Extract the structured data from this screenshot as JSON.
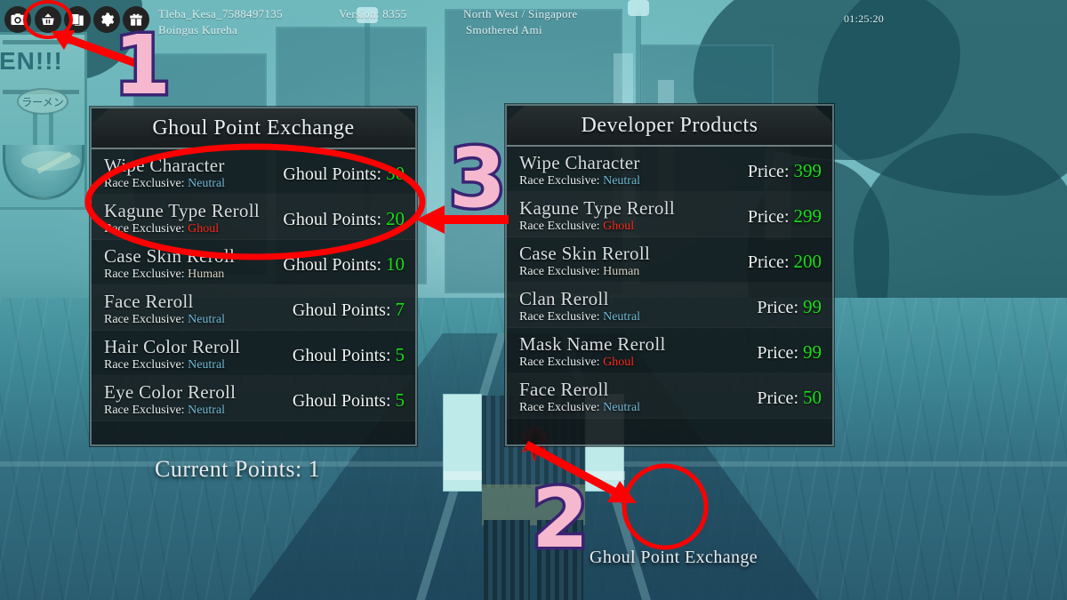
{
  "hud": {
    "icons": [
      {
        "name": "camera-icon",
        "label": "Screenshot"
      },
      {
        "name": "shop-basket-icon",
        "label": "Shop"
      },
      {
        "name": "inventory-book-icon",
        "label": "Inventory"
      },
      {
        "name": "gear-icon",
        "label": "Settings"
      },
      {
        "name": "gift-box-icon",
        "label": "Gifts"
      }
    ],
    "username": "Tleba_Kesa_7588497135",
    "display_name": "Boingus Kureha",
    "version": "Version: 8355",
    "region": "North West / Singapore",
    "server_name": "Smothered Ami",
    "clock": "01:25:20"
  },
  "exchange_panel": {
    "title": "Ghoul Point Exchange",
    "price_label": "Ghoul Points:",
    "race_label": "Race Exclusive:",
    "rows": [
      {
        "name": "Wipe Character",
        "race": "Neutral",
        "race_class": "race-neutral",
        "price": "30"
      },
      {
        "name": "Kagune Type Reroll",
        "race": "Ghoul",
        "race_class": "race-ghoul",
        "price": "20"
      },
      {
        "name": "Case Skin Reroll",
        "race": "Human",
        "race_class": "race-human",
        "price": "10"
      },
      {
        "name": "Face Reroll",
        "race": "Neutral",
        "race_class": "race-neutral",
        "price": "7"
      },
      {
        "name": "Hair Color Reroll",
        "race": "Neutral",
        "race_class": "race-neutral",
        "price": "5"
      },
      {
        "name": "Eye Color Reroll",
        "race": "Neutral",
        "race_class": "race-neutral",
        "price": "5"
      }
    ],
    "current_points": "Current Points: 1"
  },
  "developer_panel": {
    "title": "Developer Products",
    "price_label": "Price:",
    "race_label": "Race Exclusive:",
    "rows": [
      {
        "name": "Wipe Character",
        "race": "Neutral",
        "race_class": "race-neutral",
        "price": "399"
      },
      {
        "name": "Kagune Type Reroll",
        "race": "Ghoul",
        "race_class": "race-ghoul",
        "price": "299"
      },
      {
        "name": "Case Skin Reroll",
        "race": "Human",
        "race_class": "race-human",
        "price": "200"
      },
      {
        "name": "Clan Reroll",
        "race": "Neutral",
        "race_class": "race-neutral",
        "price": "99"
      },
      {
        "name": "Mask Name Reroll",
        "race": "Ghoul",
        "race_class": "race-ghoul",
        "price": "99"
      },
      {
        "name": "Face Reroll",
        "race": "Neutral",
        "race_class": "race-neutral",
        "price": "50"
      }
    ]
  },
  "world": {
    "npc_label": "Ghoul Point Exchange",
    "shop_sign_text": "EN!!!",
    "shop_sign_badge": "ラーメン"
  },
  "annotations": {
    "step1": "1",
    "step2": "2",
    "step3": "3",
    "highlight_color": "#ff0000",
    "number_fill": "#f5b8cf",
    "number_stroke": "#3b2473"
  },
  "colors": {
    "price_green": "#17e016",
    "race_neutral": "#6fb9d6",
    "race_ghoul": "#ff2a18",
    "panel_bg": "#101618",
    "panel_border": "#96b9be"
  }
}
